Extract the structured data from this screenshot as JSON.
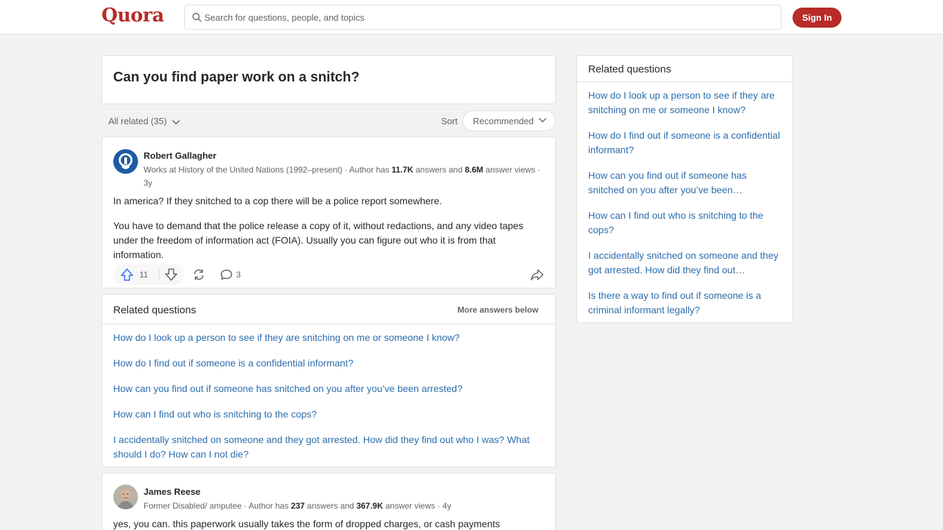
{
  "header": {
    "logo": "Quora",
    "search_placeholder": "Search for questions, people, and topics",
    "signin_label": "Sign In"
  },
  "question": {
    "title": "Can you find paper work on a snitch?"
  },
  "toolbar": {
    "filter_label": "All related (35)",
    "sort_label": "Sort",
    "sort_value": "Recommended"
  },
  "answers": [
    {
      "author": "Robert Gallagher",
      "cred_prefix": "Works at History of the United Nations (1992–present) · Author has ",
      "answers_count": "11.7K",
      "cred_mid": " answers and ",
      "views_count": "8.6M",
      "cred_suffix": " answer views · 3y",
      "paragraphs": [
        "In america? If they snitched to a cop there will be a police report somewhere.",
        "You have to demand that the police release a copy of it, without redactions, and any video tapes under the freedom of information act (FOIA). Usually you can figure out who it is from that information."
      ],
      "upvotes": "11",
      "comments": "3"
    },
    {
      "author": "James Reese",
      "cred_prefix": "Former Disabled/ amputee · Author has ",
      "answers_count": "237",
      "cred_mid": " answers and ",
      "views_count": "367.9K",
      "cred_suffix": " answer views · 4y",
      "paragraphs": [
        "yes, you can. this paperwork usually takes the form of dropped charges, or cash payments"
      ]
    }
  ],
  "related_mid": {
    "title": "Related questions",
    "more_label": "More answers below",
    "items": [
      "How do I look up a person to see if they are snitching on me or someone I know?",
      "How do I find out if someone is a confidential informant?",
      "How can you find out if someone has snitched on you after you’ve been arrested?",
      "How can I find out who is snitching to the cops?",
      "I accidentally snitched on someone and they got arrested. How did they find out who I was? What should I do? How can I not die?"
    ]
  },
  "sidebar": {
    "title": "Related questions",
    "items": [
      "How do I look up a person to see if they are snitching on me or someone I know?",
      "How do I find out if someone is a confidential informant?",
      "How can you find out if someone has snitched on you after you’ve been…",
      "How can I find out who is snitching to the cops?",
      "I accidentally snitched on someone and they got arrested. How did they find out…",
      "Is there a way to find out if someone is a criminal informant legally?"
    ]
  },
  "colors": {
    "brand": "#b92b27",
    "link": "#2b6dad",
    "upvote": "#2e69ff"
  }
}
